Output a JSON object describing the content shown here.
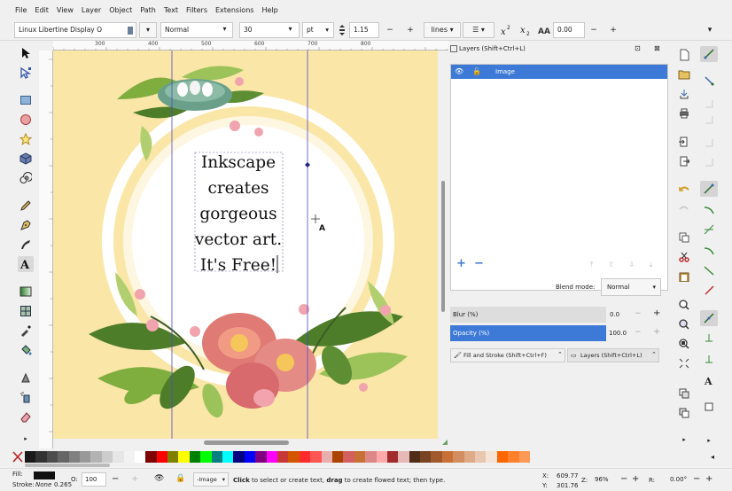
{
  "menu": [
    "File",
    "Edit",
    "View",
    "Layer",
    "Object",
    "Path",
    "Text",
    "Filters",
    "Extensions",
    "Help"
  ],
  "text_toolbar": {
    "font_family": "Linux Libertine Display O",
    "font_style": "Normal",
    "font_size": "30",
    "unit": "pt",
    "line_spacing": "1.15",
    "spacing_mode": "lines",
    "letter_spacing": "0.00",
    "minus": "−",
    "plus": "+"
  },
  "ruler": {
    "labels": [
      "300",
      "400",
      "500",
      "600",
      "700",
      "800"
    ]
  },
  "canvas_text": [
    "Inkscape",
    "creates",
    "gorgeous",
    "vector art.",
    "It's Free!"
  ],
  "layers_panel": {
    "title": "Layers (Shift+Ctrl+L)",
    "layers": [
      {
        "name": "Image",
        "selected": true
      }
    ],
    "add": "+",
    "remove": "−",
    "blend_label": "Blend mode:",
    "blend_value": "Normal",
    "blur_label": "Blur (%)",
    "blur_value": "0.0",
    "opacity_label": "Opacity (%)",
    "opacity_value": "100.0"
  },
  "dock_tabs": [
    {
      "label": "Fill and Stroke (Shift+Ctrl+F)"
    },
    {
      "label": "Layers (Shift+Ctrl+L)"
    }
  ],
  "palette": [
    "#1a1a1a",
    "#333333",
    "#4d4d4d",
    "#666666",
    "#808080",
    "#999999",
    "#b3b3b3",
    "#cccccc",
    "#e6e6e6",
    "#f2f2f2",
    "#ffffff",
    "#800000",
    "#ff0000",
    "#808000",
    "#ffff00",
    "#008000",
    "#00ff00",
    "#008080",
    "#00ffff",
    "#000080",
    "#0000ff",
    "#800080",
    "#ff00ff",
    "#c83737",
    "#d45500",
    "#ff2a2a",
    "#ff5555",
    "#e9afaf",
    "#aa4400",
    "#d35f5f",
    "#c87137",
    "#de8787",
    "#ffaaaa",
    "#a02c2c",
    "#e6b8b8",
    "#502d16",
    "#784421",
    "#a05a2c",
    "#c87137",
    "#d38d5f",
    "#deaa87",
    "#e9c6af",
    "#f4e3d7",
    "#ff6600",
    "#ff7f2a",
    "#ff9955"
  ],
  "status": {
    "fill_label": "Fill:",
    "stroke_label": "Stroke:",
    "stroke_value": "None",
    "stroke_width": "0.265",
    "opacity_label": "O:",
    "opacity_value": "100",
    "layer": "-Image",
    "message_bold1": "Click",
    "message_1": " to select or create text, ",
    "message_bold2": "drag",
    "message_2": " to create flowed text; then type.",
    "x_label": "X:",
    "x_value": "609.77",
    "y_label": "Y:",
    "y_value": "301.76",
    "zoom_label": "Z:",
    "zoom_value": "96%",
    "rotate_label": "R:",
    "rotate_value": "0.00°",
    "minus": "−",
    "plus": "+"
  }
}
